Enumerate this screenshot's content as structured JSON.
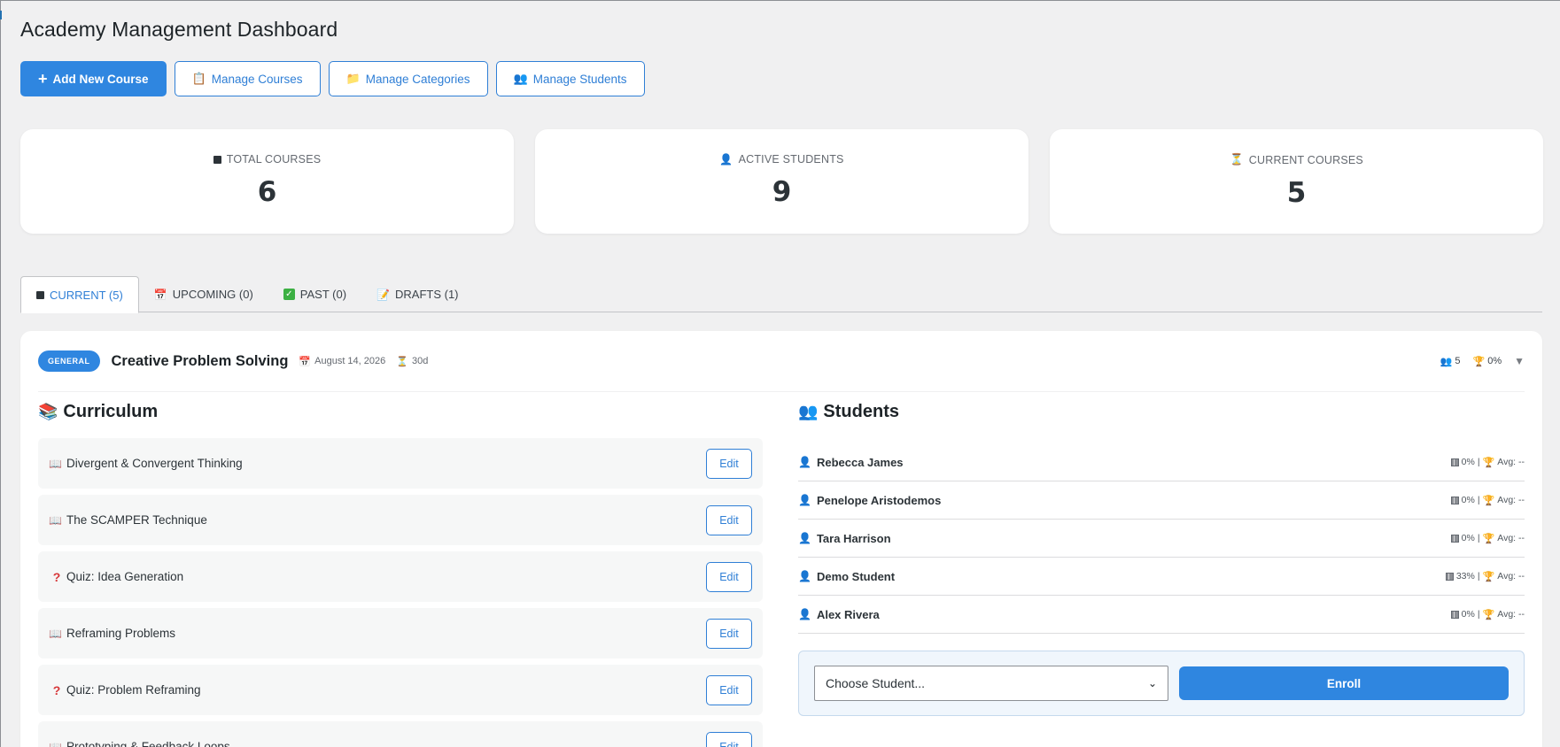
{
  "page": {
    "title": "Academy Management Dashboard"
  },
  "toolbar": {
    "add_course": "Add New Course",
    "manage_courses": "Manage Courses",
    "manage_categories": "Manage Categories",
    "manage_students": "Manage Students"
  },
  "stats": [
    {
      "label": "TOTAL COURSES",
      "value": "6"
    },
    {
      "label": "ACTIVE STUDENTS",
      "value": "9"
    },
    {
      "label": "CURRENT COURSES",
      "value": "5"
    }
  ],
  "tabs": [
    {
      "label": "CURRENT (5)"
    },
    {
      "label": "UPCOMING (0)"
    },
    {
      "label": "PAST (0)"
    },
    {
      "label": "DRAFTS (1)"
    }
  ],
  "course": {
    "badge": "GENERAL",
    "title": "Creative Problem Solving",
    "date": "August 14, 2026",
    "duration": "30d",
    "students_count": "5",
    "completion": "0%"
  },
  "curriculum": {
    "title": "Curriculum",
    "edit_label": "Edit",
    "items": [
      {
        "type": "lesson",
        "name": "Divergent & Convergent Thinking"
      },
      {
        "type": "lesson",
        "name": "The SCAMPER Technique"
      },
      {
        "type": "quiz",
        "name": "Quiz: Idea Generation"
      },
      {
        "type": "lesson",
        "name": "Reframing Problems"
      },
      {
        "type": "quiz",
        "name": "Quiz: Problem Reframing"
      },
      {
        "type": "lesson",
        "name": "Prototyping & Feedback Loops"
      }
    ]
  },
  "students": {
    "title": "Students",
    "list": [
      {
        "name": "Rebecca James",
        "progress": "0%",
        "avg": "Avg: --"
      },
      {
        "name": "Penelope Aristodemos",
        "progress": "0%",
        "avg": "Avg: --"
      },
      {
        "name": "Tara Harrison",
        "progress": "0%",
        "avg": "Avg: --"
      },
      {
        "name": "Demo Student",
        "progress": "33%",
        "avg": "Avg: --"
      },
      {
        "name": "Alex Rivera",
        "progress": "0%",
        "avg": "Avg: --"
      }
    ]
  },
  "enroll": {
    "select_value": "Choose Student...",
    "button": "Enroll"
  }
}
